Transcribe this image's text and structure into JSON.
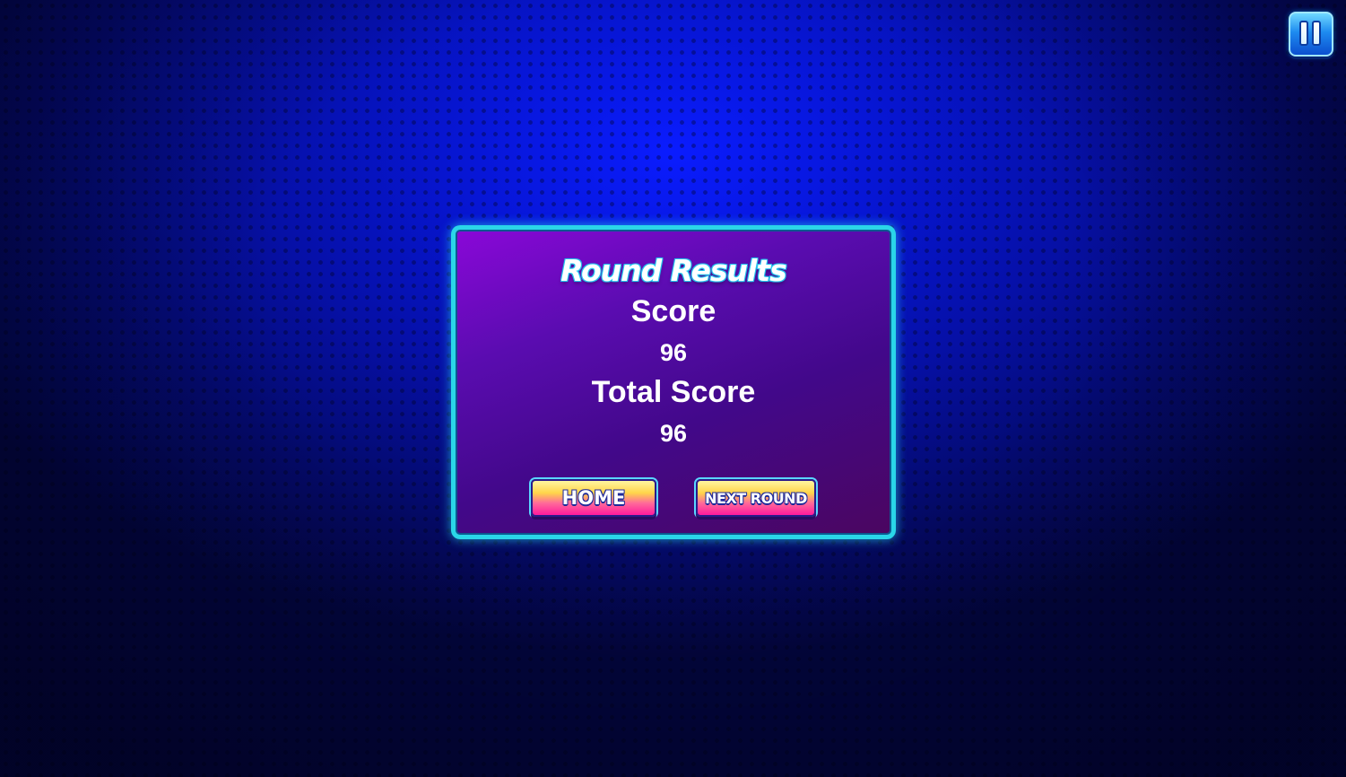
{
  "hud": {
    "pause_icon": "pause-icon"
  },
  "results": {
    "title": "Round Results",
    "score_label": "Score",
    "score_value": "96",
    "total_label": "Total Score",
    "total_value": "96"
  },
  "buttons": {
    "home_label": "HOME",
    "next_label": "NEXT ROUND"
  },
  "colors": {
    "background": "#0716d6",
    "panel_border": "#2ad6e8",
    "panel_top": "#8a08d8",
    "button_top": "#ffd54a",
    "button_bottom": "#ff1a9c",
    "pause_button": "#1e8bf0"
  }
}
